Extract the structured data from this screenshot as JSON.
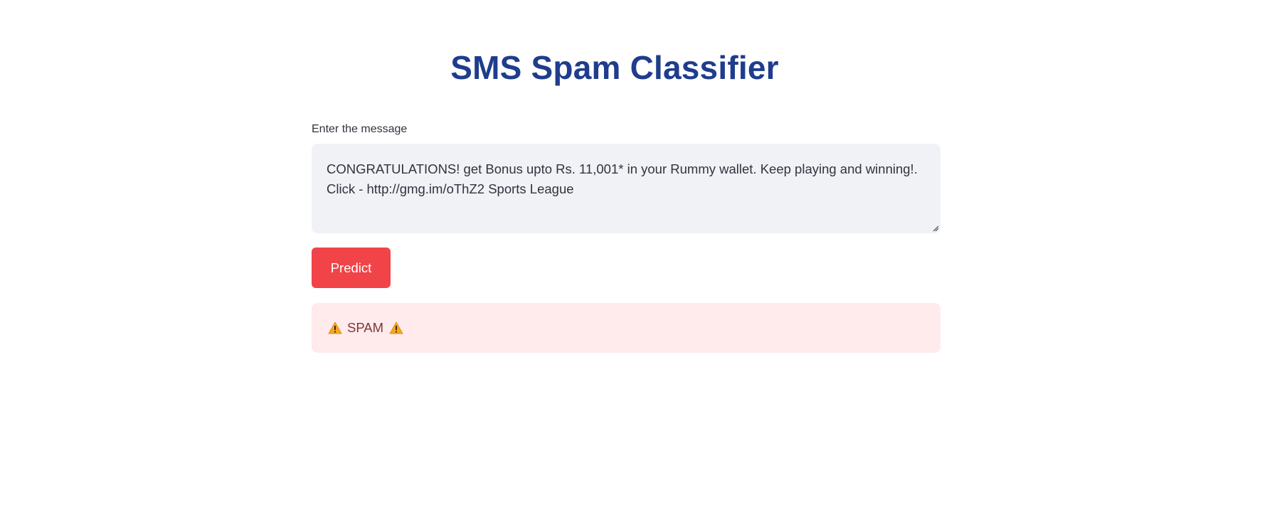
{
  "header": {
    "title": "SMS Spam Classifier"
  },
  "form": {
    "message_label": "Enter the message",
    "message_value": "CONGRATULATIONS! get Bonus upto Rs. 11,001* in your Rummy wallet. Keep playing and winning!.\nClick - http://gmg.im/oThZ2 Sports League",
    "predict_label": "Predict"
  },
  "result": {
    "text": "SPAM",
    "icon": "warning-icon"
  },
  "colors": {
    "title": "#1f3d8c",
    "button": "#f04448",
    "alert_bg": "#ffebec",
    "alert_text": "#7d353b",
    "textarea_bg": "#f0f2f6"
  }
}
